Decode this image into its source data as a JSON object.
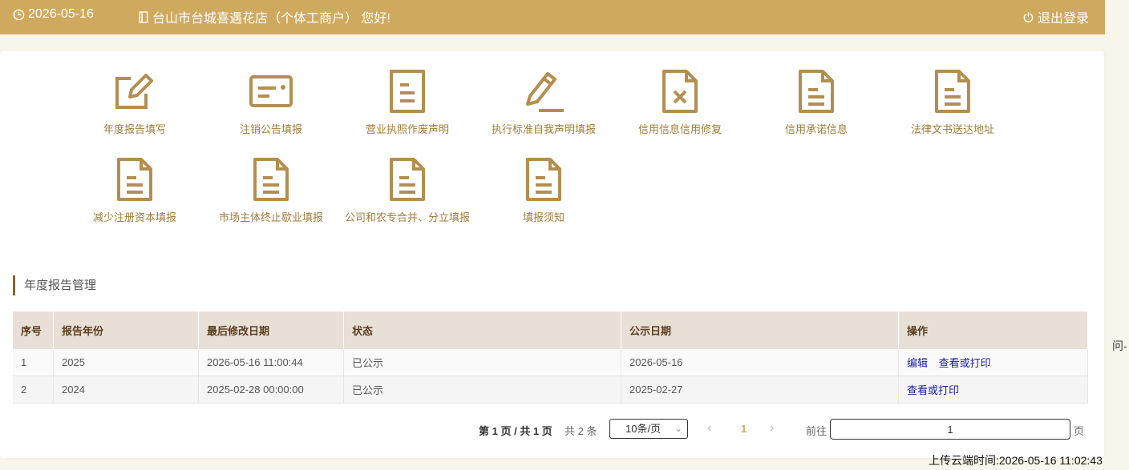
{
  "header": {
    "date": "2026-05-16",
    "shop_name": "台山市台城喜遇花店（个体工商户） 您好!",
    "logout_label": "退出登录",
    "bg_color": "#cfa95e"
  },
  "tiles": [
    {
      "label": "年度报告填写",
      "icon": "edit-square-icon"
    },
    {
      "label": "注销公告填报",
      "icon": "id-card-icon"
    },
    {
      "label": "营业执照作废声明",
      "icon": "document-icon"
    },
    {
      "label": "执行标准自我声明填报",
      "icon": "pencil-icon"
    },
    {
      "label": "信用信息信用修复",
      "icon": "document-x-icon"
    },
    {
      "label": "信用承诺信息",
      "icon": "document-icon"
    },
    {
      "label": "法律文书送达地址",
      "icon": "document-icon"
    },
    {
      "label": "减少注册资本填报",
      "icon": "document-icon"
    },
    {
      "label": "市场主体终止歇业填报",
      "icon": "document-icon"
    },
    {
      "label": "公司和农专合并、分立填报",
      "icon": "document-icon"
    },
    {
      "label": "填报须知",
      "icon": "document-icon"
    }
  ],
  "section_title": "年度报告管理",
  "table": {
    "headers": [
      "序号",
      "报告年份",
      "最后修改日期",
      "状态",
      "公示日期",
      "操作"
    ],
    "rows": [
      {
        "no": "1",
        "year": "2025",
        "modified": "2026-05-16 11:00:44",
        "status": "已公示",
        "publish_date": "2026-05-16",
        "actions": [
          "编辑",
          "查看或打印"
        ]
      },
      {
        "no": "2",
        "year": "2024",
        "modified": "2025-02-28 00:00:00",
        "status": "已公示",
        "publish_date": "2025-02-27",
        "actions": [
          "查看或打印"
        ]
      }
    ]
  },
  "pagination": {
    "page_info": "第 1 页 / 共 1 页",
    "total": "共 2 条",
    "page_size": "10条/页",
    "current_page": "1",
    "goto_label": "前往",
    "goto_value": "1",
    "page_unit": "页"
  },
  "side_text": "问-",
  "upload_time": "上传云端时间:2026-05-16 11:02:43",
  "accent_color": "#b48e4f"
}
